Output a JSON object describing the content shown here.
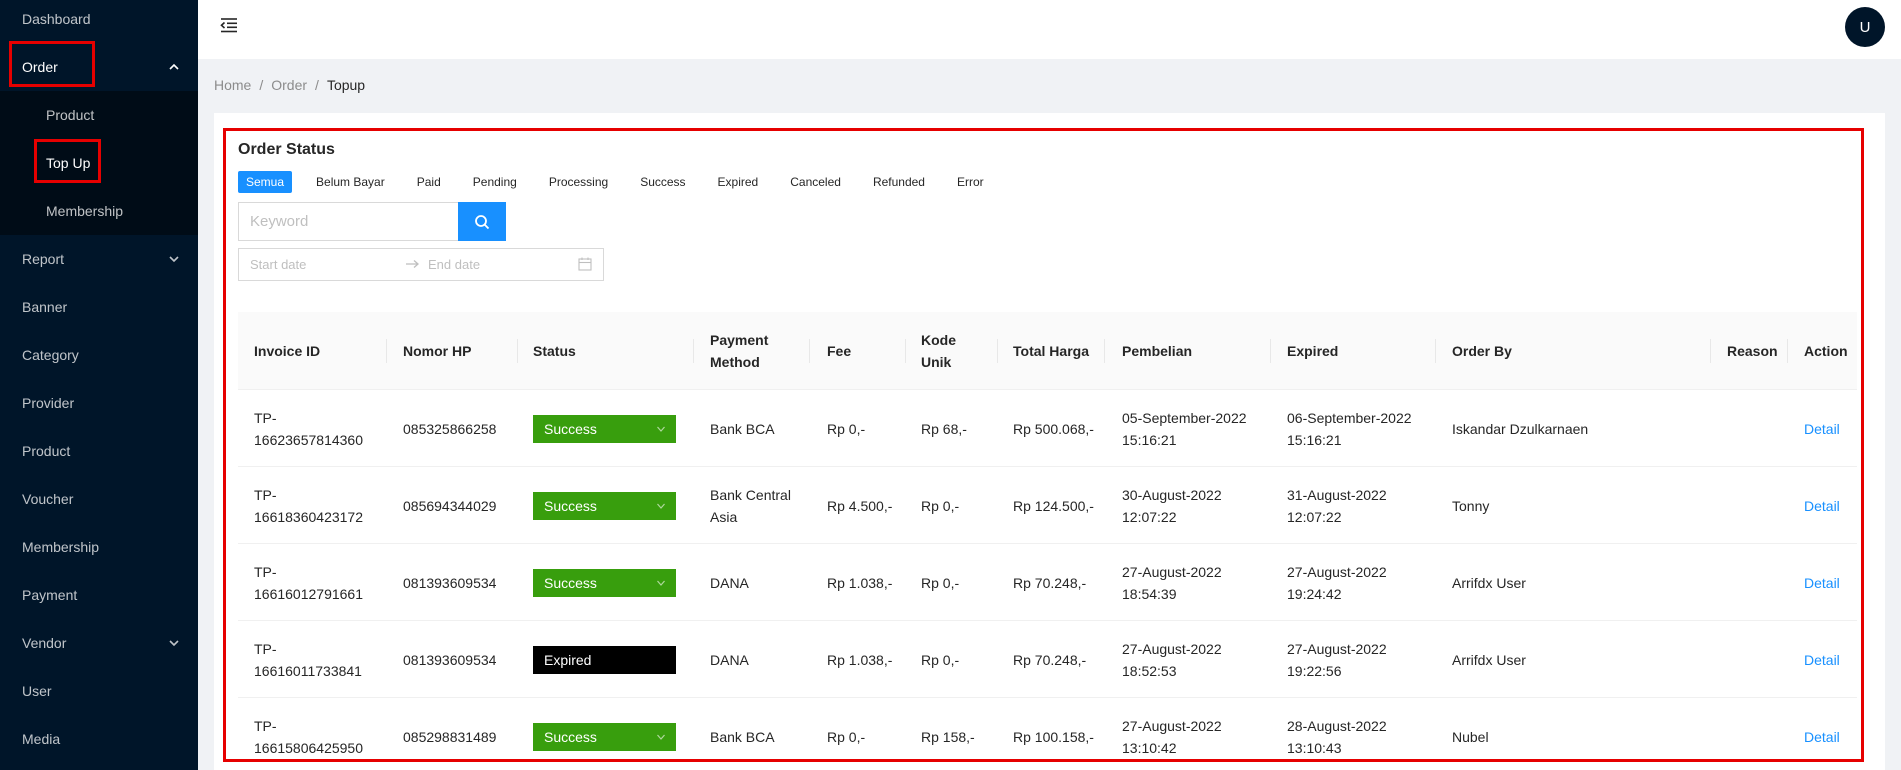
{
  "sidebar": {
    "items": [
      {
        "label": "Dashboard"
      },
      {
        "label": "Order"
      },
      {
        "label": "Product"
      },
      {
        "label": "Top Up"
      },
      {
        "label": "Membership"
      },
      {
        "label": "Report"
      },
      {
        "label": "Banner"
      },
      {
        "label": "Category"
      },
      {
        "label": "Provider"
      },
      {
        "label": "Product"
      },
      {
        "label": "Voucher"
      },
      {
        "label": "Membership"
      },
      {
        "label": "Payment"
      },
      {
        "label": "Vendor"
      },
      {
        "label": "User"
      },
      {
        "label": "Media"
      }
    ]
  },
  "header": {
    "menu_icon": "menu-fold-icon",
    "avatar_initial": "U"
  },
  "breadcrumb": {
    "items": [
      "Home",
      "Order",
      "Topup"
    ],
    "separator": "/"
  },
  "card": {
    "title": "Order Status",
    "tabs": [
      "Semua",
      "Belum Bayar",
      "Paid",
      "Pending",
      "Processing",
      "Success",
      "Expired",
      "Canceled",
      "Refunded",
      "Error"
    ],
    "active_tab": "Semua",
    "search": {
      "placeholder": "Keyword"
    },
    "date_range": {
      "start_placeholder": "Start date",
      "end_placeholder": "End date"
    }
  },
  "table": {
    "columns": [
      {
        "line1": "Invoice ID",
        "line2": ""
      },
      {
        "line1": "Nomor HP",
        "line2": ""
      },
      {
        "line1": "Status",
        "line2": ""
      },
      {
        "line1": "Payment",
        "line2": "Method"
      },
      {
        "line1": "Fee",
        "line2": ""
      },
      {
        "line1": "Kode",
        "line2": "Unik"
      },
      {
        "line1": "Total Harga",
        "line2": ""
      },
      {
        "line1": "Pembelian",
        "line2": ""
      },
      {
        "line1": "Expired",
        "line2": ""
      },
      {
        "line1": "Order By",
        "line2": ""
      },
      {
        "line1": "Reason",
        "line2": ""
      },
      {
        "line1": "Action",
        "line2": ""
      }
    ],
    "rows": [
      {
        "invoice1": "TP-",
        "invoice2": "16623657814360",
        "phone": "085325866258",
        "status": "Success",
        "payment1": "Bank BCA",
        "payment2": "",
        "fee": "Rp 0,-",
        "kode": "Rp 68,-",
        "total": "Rp 500.068,-",
        "beli1": "05-September-2022",
        "beli2": "15:16:21",
        "exp1": "06-September-2022",
        "exp2": "15:16:21",
        "order_by": "Iskandar Dzulkarnaen",
        "reason": "",
        "action": "Detail"
      },
      {
        "invoice1": "TP-",
        "invoice2": "16618360423172",
        "phone": "085694344029",
        "status": "Success",
        "payment1": "Bank Central",
        "payment2": "Asia",
        "fee": "Rp 4.500,-",
        "kode": "Rp 0,-",
        "total": "Rp 124.500,-",
        "beli1": "30-August-2022",
        "beli2": "12:07:22",
        "exp1": "31-August-2022",
        "exp2": "12:07:22",
        "order_by": "Tonny",
        "reason": "",
        "action": "Detail"
      },
      {
        "invoice1": "TP-",
        "invoice2": "16616012791661",
        "phone": "081393609534",
        "status": "Success",
        "payment1": "DANA",
        "payment2": "",
        "fee": "Rp 1.038,-",
        "kode": "Rp 0,-",
        "total": "Rp 70.248,-",
        "beli1": "27-August-2022",
        "beli2": "18:54:39",
        "exp1": "27-August-2022",
        "exp2": "19:24:42",
        "order_by": "Arrifdx User",
        "reason": "",
        "action": "Detail"
      },
      {
        "invoice1": "TP-",
        "invoice2": "16616011733841",
        "phone": "081393609534",
        "status": "Expired",
        "payment1": "DANA",
        "payment2": "",
        "fee": "Rp 1.038,-",
        "kode": "Rp 0,-",
        "total": "Rp 70.248,-",
        "beli1": "27-August-2022",
        "beli2": "18:52:53",
        "exp1": "27-August-2022",
        "exp2": "19:22:56",
        "order_by": "Arrifdx User",
        "reason": "",
        "action": "Detail"
      },
      {
        "invoice1": "TP-",
        "invoice2": "16615806425950",
        "phone": "085298831489",
        "status": "Success",
        "payment1": "Bank BCA",
        "payment2": "",
        "fee": "Rp 0,-",
        "kode": "Rp 158,-",
        "total": "Rp 100.158,-",
        "beli1": "27-August-2022",
        "beli2": "13:10:42",
        "exp1": "28-August-2022",
        "exp2": "13:10:43",
        "order_by": "Nubel",
        "reason": "",
        "action": "Detail"
      }
    ]
  },
  "colors": {
    "sidebar_bg": "#001529",
    "primary": "#1890ff",
    "success": "#389e0d",
    "expired": "#000000",
    "highlight": "#e60000"
  }
}
